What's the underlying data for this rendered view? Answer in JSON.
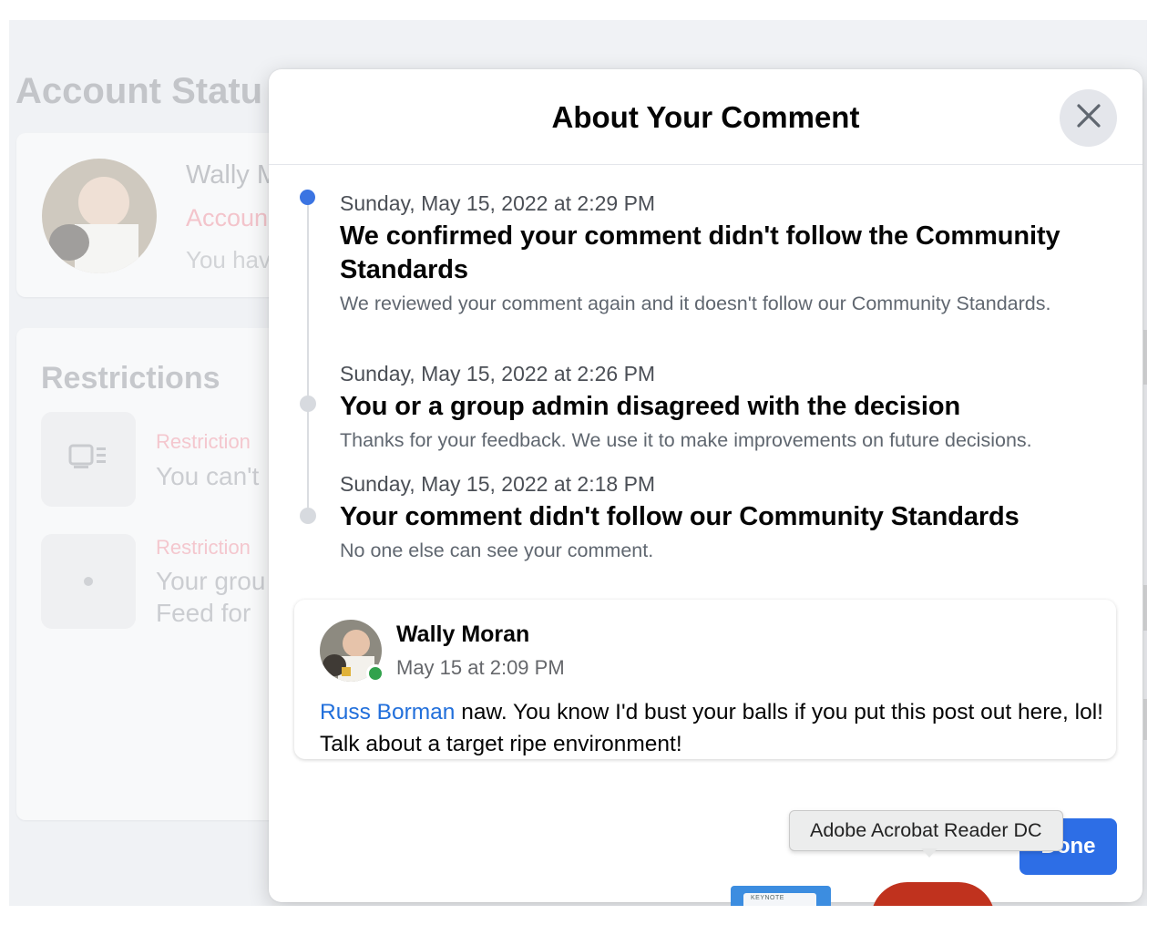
{
  "background": {
    "page_title": "Account Statu",
    "profile": {
      "name": "Wally M",
      "account_label": "Accoun",
      "note": "You hav"
    },
    "restrictions": {
      "title": "Restrictions",
      "items": [
        {
          "label": "Restriction",
          "text": "You can't"
        },
        {
          "label": "Restriction",
          "text": "Your grou\nFeed for"
        }
      ]
    }
  },
  "modal": {
    "title": "About Your Comment",
    "close_icon": "close-icon",
    "timeline": [
      {
        "date": "Sunday, May 15, 2022 at 2:29 PM",
        "title": "We confirmed your comment didn't follow the Community Standards",
        "description": "We reviewed your comment again and it doesn't follow our Community Standards.",
        "active": true
      },
      {
        "date": "Sunday, May 15, 2022 at 2:26 PM",
        "title": "You or a group admin disagreed with the decision",
        "description": "Thanks for your feedback. We use it to make improvements on future decisions.",
        "active": false
      },
      {
        "date": "Sunday, May 15, 2022 at 2:18 PM",
        "title": "Your comment didn't follow our Community Standards",
        "description": "No one else can see your comment.",
        "active": false
      }
    ],
    "comment": {
      "author": "Wally Moran",
      "time": "May 15 at 2:09 PM",
      "mention": "Russ Borman",
      "text": " naw. You know I'd bust your balls if you put this post out here, lol! Talk about a target ripe environment!"
    },
    "done_label": "Done"
  },
  "tooltip": {
    "text": "Adobe Acrobat Reader DC"
  },
  "dock": {
    "keynote_label": "KEYNOTE"
  },
  "colors": {
    "accent": "#2d6ee6",
    "active_dot": "#3b74e2",
    "mention": "#216fdb",
    "online": "#31a24c"
  }
}
